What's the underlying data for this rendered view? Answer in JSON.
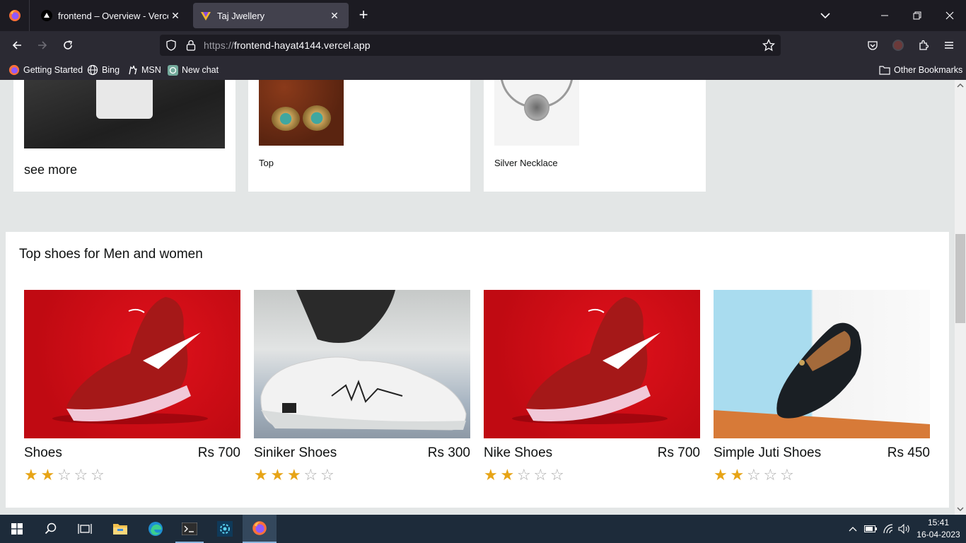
{
  "browser": {
    "tabs": [
      {
        "title": "frontend – Overview - Vercel",
        "active": false
      },
      {
        "title": "Taj Jwellery",
        "active": true
      }
    ],
    "url_scheme": "https://",
    "url_host": "frontend-hayat4144.vercel.app",
    "bookmarks": [
      "Getting Started",
      "Bing",
      "MSN",
      "New chat"
    ],
    "other_bookmarks": "Other Bookmarks"
  },
  "page": {
    "top_cards": {
      "see_more": "see more",
      "items": [
        {
          "caption": "Top",
          "image": "earrings-photo"
        },
        {
          "caption": "Silver Necklace",
          "image": "necklace-photo"
        }
      ]
    },
    "shoes_section": {
      "title": "Top shoes for Men and women",
      "products": [
        {
          "name": "Shoes",
          "price": "Rs 700",
          "rating": 2,
          "max_rating": 5,
          "image": "red-nike-sneaker"
        },
        {
          "name": "Siniker Shoes",
          "price": "Rs 300",
          "rating": 3,
          "max_rating": 5,
          "image": "white-sneaker-on-foot"
        },
        {
          "name": "Nike Shoes",
          "price": "Rs 700",
          "rating": 2,
          "max_rating": 5,
          "image": "red-nike-sneaker"
        },
        {
          "name": "Simple Juti Shoes",
          "price": "Rs 450",
          "rating": 2,
          "max_rating": 5,
          "image": "black-loafer"
        }
      ]
    }
  },
  "taskbar": {
    "time": "15:41",
    "date": "16-04-2023",
    "apps": [
      "start-icon",
      "search-icon",
      "task-view-icon",
      "file-explorer-icon",
      "edge-icon",
      "terminal-icon",
      "settings-app-icon",
      "firefox-icon"
    ]
  },
  "colors": {
    "star_on": "#e7a416",
    "star_off": "#a8a8a8",
    "page_bg": "#e3e6e6",
    "browser_chrome": "#2b2a33"
  }
}
